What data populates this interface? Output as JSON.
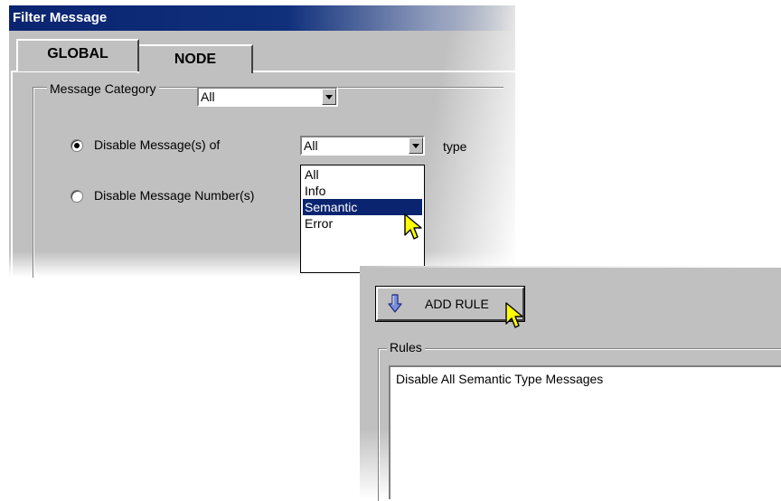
{
  "dialog_title": "Filter Message",
  "tabs": [
    {
      "label": "GLOBAL",
      "active": true
    },
    {
      "label": "NODE",
      "active": false
    }
  ],
  "message_category": {
    "label": "Message Category",
    "value": "All"
  },
  "options": {
    "disable_messages_of": {
      "label": "Disable Message(s) of",
      "selected": true
    },
    "disable_message_numbers": {
      "label": "Disable Message Number(s)",
      "selected": false
    }
  },
  "type_combo": {
    "value": "All",
    "suffix_label": "type",
    "dropdown_options": [
      "All",
      "Info",
      "Semantic",
      "Error"
    ],
    "highlighted": "Semantic"
  },
  "add_rule_button": {
    "label": "ADD RULE",
    "icon": "down-arrow-icon"
  },
  "rules": {
    "label": "Rules",
    "items": [
      "Disable All Semantic Type Messages"
    ]
  },
  "colors": {
    "titlebar": "#0a2470",
    "selection": "#0a2470",
    "face": "#c0c0c0",
    "cursor": "#ffff00"
  }
}
